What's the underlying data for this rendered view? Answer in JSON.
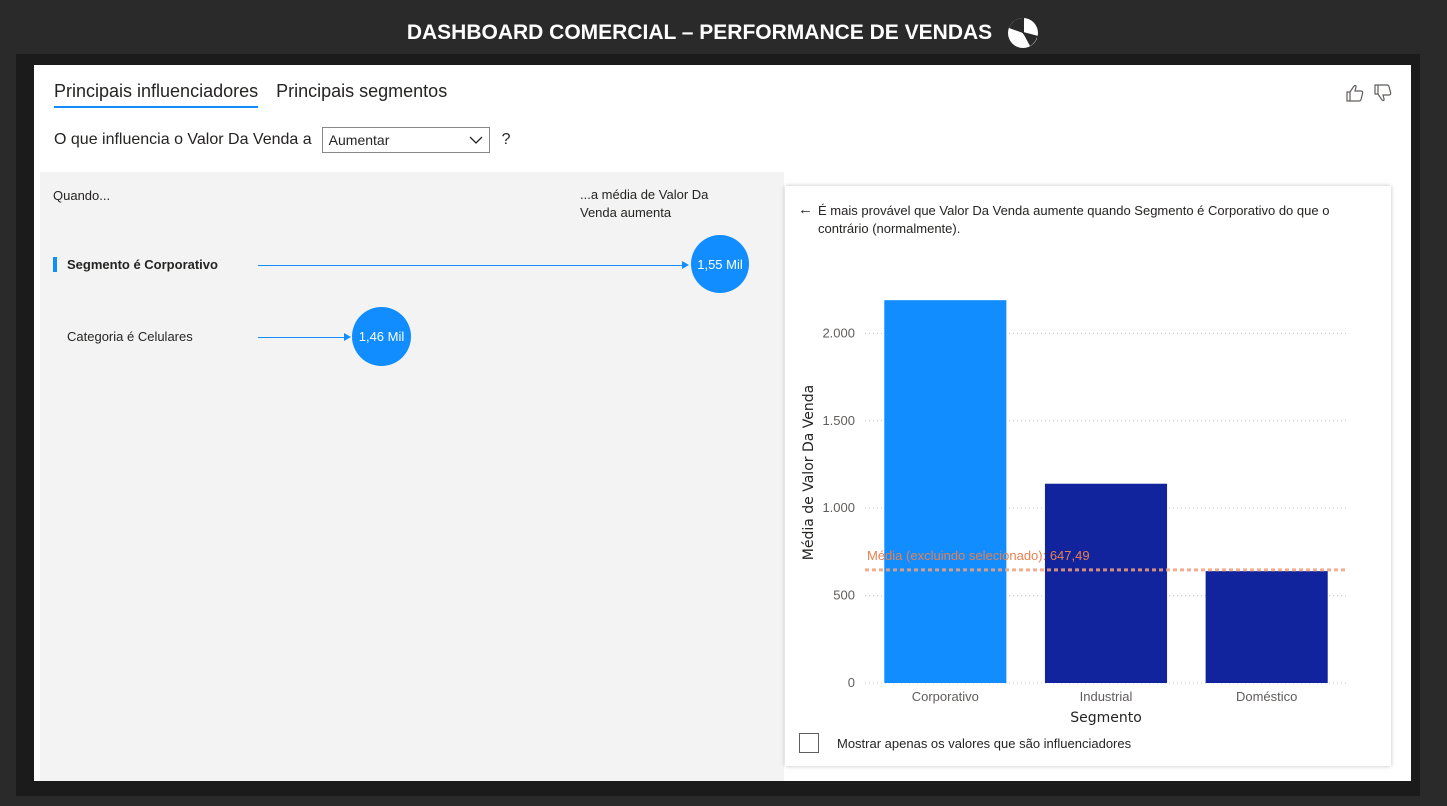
{
  "header": {
    "title": "DASHBOARD COMERCIAL – PERFORMANCE DE VENDAS",
    "icon": "pie-chart-icon"
  },
  "tabs": [
    {
      "label": "Principais influenciadores",
      "active": true
    },
    {
      "label": "Principais segmentos",
      "active": false
    }
  ],
  "question": {
    "prefix": "O que influencia o Valor Da Venda a",
    "selected": "Aumentar",
    "suffix": "?"
  },
  "left": {
    "when_label": "Quando...",
    "avg_label": "...a média de Valor Da Venda aumenta",
    "influencers": [
      {
        "label": "Segmento é Corporativo",
        "value": "1,55 Mil",
        "selected": true
      },
      {
        "label": "Categoria é Celulares",
        "value": "1,46 Mil",
        "selected": false
      }
    ]
  },
  "detail": {
    "back_icon": "arrow-left-icon",
    "description": "É mais provável que Valor Da Venda aumente quando Segmento é Corporativo do que o contrário (normalmente).",
    "checkbox_label": "Mostrar apenas os valores que são influenciadores"
  },
  "chart_data": {
    "type": "bar",
    "categories": [
      "Corporativo",
      "Industrial",
      "Doméstico"
    ],
    "values": [
      2190,
      1140,
      640
    ],
    "xlabel": "Segmento",
    "ylabel": "Média de Valor Da Venda",
    "ylim": [
      0,
      2500
    ],
    "yticks": [
      0,
      500,
      1000,
      1500,
      2000
    ],
    "ytick_labels": [
      "0",
      "500",
      "1.000",
      "1.500",
      "2.000"
    ],
    "bar_colors": [
      "#118dff",
      "#12239e",
      "#12239e"
    ],
    "reference_line": {
      "value": 647.49,
      "label": "Média (excluindo selecionado): 647,49",
      "color": "#f2a17a"
    },
    "grid": true
  },
  "colors": {
    "accent": "#118dff",
    "dark_bar": "#12239e",
    "reference": "#f2a17a"
  }
}
